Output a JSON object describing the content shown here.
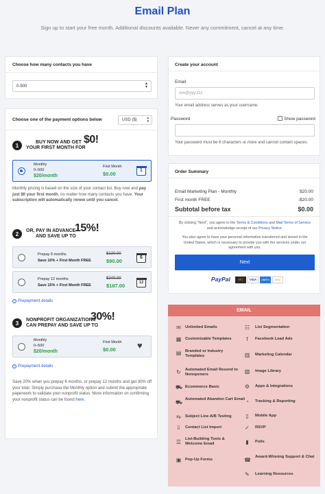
{
  "header": {
    "title": "Email Plan",
    "subtitle": "Sign up to start your free month. Additional discounts available. Never any commitment, cancel at any time."
  },
  "contacts": {
    "heading": "Choose how many contacts you have",
    "value": "0-500"
  },
  "payment": {
    "heading": "Choose one of the payment options below",
    "currency": "USD ($)",
    "section1": {
      "number": "1",
      "line1": "BUY NOW AND GET",
      "line2": "YOUR FIRST MONTH FOR",
      "big": "$0!"
    },
    "monthly": {
      "title": "Monthly",
      "range": "0–500",
      "price": "$20/month",
      "first_label": "First Month",
      "first_price": "$0.00",
      "cal": "1"
    },
    "note1_a": "Monthly pricing is based on the size of your contact list. Buy now and ",
    "note1_b": "pay just $0 your first month",
    "note1_c": ", no matter how many contacts you have. ",
    "note1_d": "Your subscription will automatically renew until you cancel.",
    "section2": {
      "number": "2",
      "line1": "OR, PAY IN ADVANCE",
      "line2": "AND SAVE UP TO",
      "big": "15%!"
    },
    "prepay6": {
      "title": "Prepay 6 months",
      "sub": "Save 10% + First Month FREE",
      "old": "$120.00",
      "new": "$90.00",
      "cal": "6"
    },
    "prepay12": {
      "title": "Prepay 12 months",
      "sub": "Save 15% + First Month FREE",
      "old": "$240.00",
      "new": "$187.00",
      "cal": "12"
    },
    "prepay_link": "Prepayment details",
    "section3": {
      "number": "3",
      "line1": "NONPROFIT ORGANIZATIONS",
      "line2": "CAN PREPAY AND SAVE UP TO",
      "big": "30%!"
    },
    "nonprofit": {
      "title": "Monthly",
      "range": "0–500",
      "price": "$20/month",
      "first_label": "First Month",
      "first_price": "$0.00"
    },
    "prepay_link2": "Prepayment details",
    "note3": "Save 20% when you prepay 6 months, or prepay 12 months and get 30% off your total. Simply purchase the Monthly option and submit the appropriate paperwork to validate your nonprofit status. More information on confirming your nonprofit status can be found ",
    "note3_link": "here."
  },
  "account": {
    "heading": "Create your account",
    "email_label": "Email",
    "email_placeholder": "xxx@yyy.zzz",
    "email_help": "Your email address serves as your username.",
    "password_label": "Password",
    "show_password": "Show password",
    "password_help": "Your password must be 6 characters or more and cannot contain spaces."
  },
  "summary": {
    "heading": "Order Summary",
    "line1_label": "Email Marketing Plan - Monthly",
    "line1_value": "$20.00",
    "line2_label": "First month FREE",
    "line2_value": "-$20.00",
    "subtotal_label": "Subtotal before tax",
    "subtotal_value": "$0.00",
    "terms_a": "By clicking \"Next\", you agree to the ",
    "terms_link1": "Terms & Conditions",
    "terms_b": " and ",
    "terms_link2": "Mail Terms of Service",
    "terms_c": " and acknowledge receipt of our ",
    "terms_link3": "Privacy Notice",
    "consent": "You also agree to have your personal information transferred and stored in the United States, which is necessary to provide you with the services under our agreement with you.",
    "next": "Next",
    "pay_logos": [
      "PayPal",
      "MC",
      "VISA",
      "AMEX",
      "DISC"
    ]
  },
  "features": {
    "heading": "EMAIL",
    "left": [
      "Unlimited Emails",
      "Customizable Templates",
      "Branded or Industry Templates",
      "Automated Email Resend to Nonopeners",
      "Ecommerce Basic",
      "Automated Abandon Cart Email",
      "Subject Line A/B Testing",
      "Contact List Import",
      "List-Building Tools & Welcome Email",
      "Pop-Up Forms"
    ],
    "right": [
      "List Segmentation",
      "Facebook Lead Ads",
      "Marketing Calendar",
      "Image Library",
      "Apps & Integrations",
      "Tracking & Reporting",
      "Mobile App",
      "RSVP",
      "Polls",
      "Award-Winning Support & Chat",
      "Learning Resources"
    ]
  },
  "colors": {
    "accent": "#1d5fd0",
    "title": "#1d4fc4",
    "green": "#23a049",
    "features_bg": "#f1cbc9",
    "features_head": "#e07571"
  }
}
